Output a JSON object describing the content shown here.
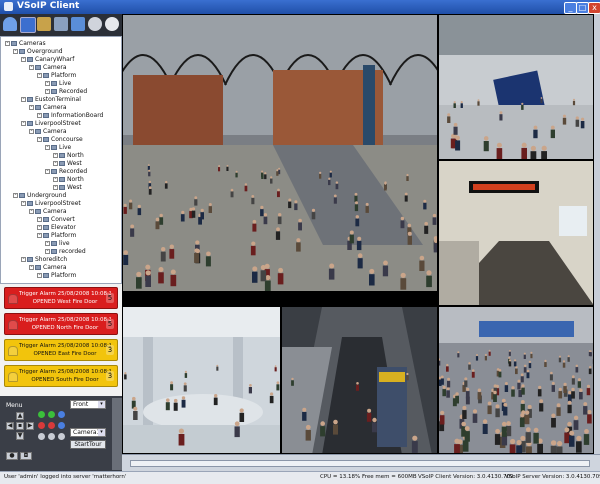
{
  "window": {
    "title": "VSoIP Client",
    "controls": [
      "_",
      "□",
      "x"
    ]
  },
  "toolbar": {
    "icons": [
      "user-icon",
      "video-wall-icon",
      "layout-icon",
      "monitor-icon",
      "tools-icon",
      "globe-icon",
      "search-icon"
    ]
  },
  "tree": {
    "nodes": [
      {
        "label": "Cameras",
        "level": 0
      },
      {
        "label": "Overground",
        "level": 1
      },
      {
        "label": "CanaryWharf",
        "level": 2
      },
      {
        "label": "Camera",
        "level": 3
      },
      {
        "label": "Platform",
        "level": 4
      },
      {
        "label": "Live",
        "level": 5
      },
      {
        "label": "Recorded",
        "level": 5
      },
      {
        "label": "EustonTerminal",
        "level": 2
      },
      {
        "label": "Camera",
        "level": 3
      },
      {
        "label": "InformationBoard",
        "level": 4
      },
      {
        "label": "LiverpoolStreet",
        "level": 2
      },
      {
        "label": "Camera",
        "level": 3
      },
      {
        "label": "Concourse",
        "level": 4
      },
      {
        "label": "Live",
        "level": 5
      },
      {
        "label": "North",
        "level": 6
      },
      {
        "label": "West",
        "level": 6
      },
      {
        "label": "Recorded",
        "level": 5
      },
      {
        "label": "North",
        "level": 6
      },
      {
        "label": "West",
        "level": 6
      },
      {
        "label": "Underground",
        "level": 1
      },
      {
        "label": "LiverpoolStreet",
        "level": 2
      },
      {
        "label": "Camera",
        "level": 3
      },
      {
        "label": "Convert",
        "level": 4
      },
      {
        "label": "Elevator",
        "level": 4
      },
      {
        "label": "Platform",
        "level": 4
      },
      {
        "label": "live",
        "level": 5
      },
      {
        "label": "recorded",
        "level": 5
      },
      {
        "label": "Shoreditch",
        "level": 2
      },
      {
        "label": "Camera",
        "level": 3
      },
      {
        "label": "Platform",
        "level": 4
      }
    ]
  },
  "alarms": [
    {
      "line1": "Trigger Alarm 25/08/2008 10:08:39",
      "line2": "OPENED West Fire Door",
      "level": "red",
      "num": "5"
    },
    {
      "line1": "Trigger Alarm 25/08/2008 10:08:39",
      "line2": "OPENED North Fire Door",
      "level": "red",
      "num": "5"
    },
    {
      "line1": "Trigger Alarm 25/08/2008 10:08:39",
      "line2": "OPENED East Fire Door",
      "level": "yellow",
      "num": "3"
    },
    {
      "line1": "Trigger Alarm 25/08/2008 10:08:39",
      "line2": "OPENED South Fire Door",
      "level": "yellow",
      "num": "3"
    }
  ],
  "ptz": {
    "menu_label": "Menu",
    "preset_select": "Front",
    "camera_select": "Camera1",
    "start_tour": "StartTour",
    "colors": {
      "green": "#3bbf3b",
      "red": "#d83a3a",
      "blue": "#4a7fe0"
    }
  },
  "statusbar": {
    "user_msg": "User 'admin' logged into server 'matterhorn'",
    "cpu": "CPU = 13.18%",
    "free_mem": "Free mem = 600MB",
    "client_version": "VSoIP Client Version: 3.0.4130.709",
    "server_version": "VSoIP Server Version: 3.0.4130.709"
  },
  "colors": {
    "title_bar": "#1f4fa8",
    "alarm_red": "#d91e1e",
    "alarm_yellow": "#f2c40c"
  }
}
